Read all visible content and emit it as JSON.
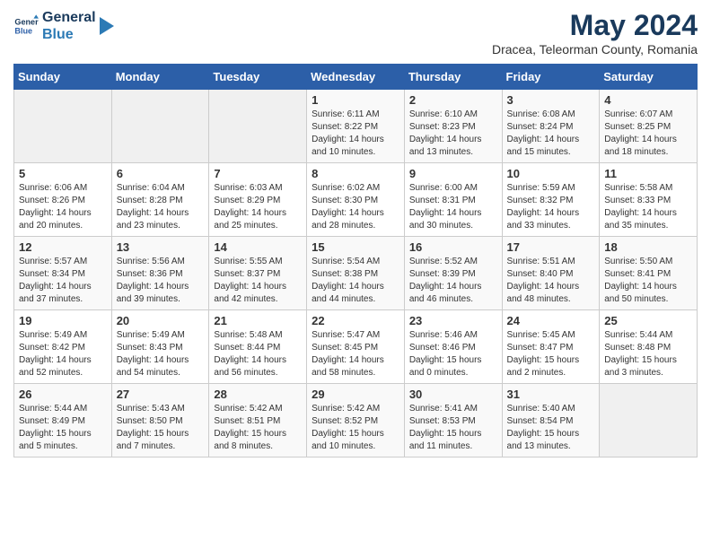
{
  "logo": {
    "line1": "General",
    "line2": "Blue"
  },
  "title": "May 2024",
  "location": "Dracea, Teleorman County, Romania",
  "days_of_week": [
    "Sunday",
    "Monday",
    "Tuesday",
    "Wednesday",
    "Thursday",
    "Friday",
    "Saturday"
  ],
  "weeks": [
    [
      {
        "num": "",
        "info": ""
      },
      {
        "num": "",
        "info": ""
      },
      {
        "num": "",
        "info": ""
      },
      {
        "num": "1",
        "info": "Sunrise: 6:11 AM\nSunset: 8:22 PM\nDaylight: 14 hours\nand 10 minutes."
      },
      {
        "num": "2",
        "info": "Sunrise: 6:10 AM\nSunset: 8:23 PM\nDaylight: 14 hours\nand 13 minutes."
      },
      {
        "num": "3",
        "info": "Sunrise: 6:08 AM\nSunset: 8:24 PM\nDaylight: 14 hours\nand 15 minutes."
      },
      {
        "num": "4",
        "info": "Sunrise: 6:07 AM\nSunset: 8:25 PM\nDaylight: 14 hours\nand 18 minutes."
      }
    ],
    [
      {
        "num": "5",
        "info": "Sunrise: 6:06 AM\nSunset: 8:26 PM\nDaylight: 14 hours\nand 20 minutes."
      },
      {
        "num": "6",
        "info": "Sunrise: 6:04 AM\nSunset: 8:28 PM\nDaylight: 14 hours\nand 23 minutes."
      },
      {
        "num": "7",
        "info": "Sunrise: 6:03 AM\nSunset: 8:29 PM\nDaylight: 14 hours\nand 25 minutes."
      },
      {
        "num": "8",
        "info": "Sunrise: 6:02 AM\nSunset: 8:30 PM\nDaylight: 14 hours\nand 28 minutes."
      },
      {
        "num": "9",
        "info": "Sunrise: 6:00 AM\nSunset: 8:31 PM\nDaylight: 14 hours\nand 30 minutes."
      },
      {
        "num": "10",
        "info": "Sunrise: 5:59 AM\nSunset: 8:32 PM\nDaylight: 14 hours\nand 33 minutes."
      },
      {
        "num": "11",
        "info": "Sunrise: 5:58 AM\nSunset: 8:33 PM\nDaylight: 14 hours\nand 35 minutes."
      }
    ],
    [
      {
        "num": "12",
        "info": "Sunrise: 5:57 AM\nSunset: 8:34 PM\nDaylight: 14 hours\nand 37 minutes."
      },
      {
        "num": "13",
        "info": "Sunrise: 5:56 AM\nSunset: 8:36 PM\nDaylight: 14 hours\nand 39 minutes."
      },
      {
        "num": "14",
        "info": "Sunrise: 5:55 AM\nSunset: 8:37 PM\nDaylight: 14 hours\nand 42 minutes."
      },
      {
        "num": "15",
        "info": "Sunrise: 5:54 AM\nSunset: 8:38 PM\nDaylight: 14 hours\nand 44 minutes."
      },
      {
        "num": "16",
        "info": "Sunrise: 5:52 AM\nSunset: 8:39 PM\nDaylight: 14 hours\nand 46 minutes."
      },
      {
        "num": "17",
        "info": "Sunrise: 5:51 AM\nSunset: 8:40 PM\nDaylight: 14 hours\nand 48 minutes."
      },
      {
        "num": "18",
        "info": "Sunrise: 5:50 AM\nSunset: 8:41 PM\nDaylight: 14 hours\nand 50 minutes."
      }
    ],
    [
      {
        "num": "19",
        "info": "Sunrise: 5:49 AM\nSunset: 8:42 PM\nDaylight: 14 hours\nand 52 minutes."
      },
      {
        "num": "20",
        "info": "Sunrise: 5:49 AM\nSunset: 8:43 PM\nDaylight: 14 hours\nand 54 minutes."
      },
      {
        "num": "21",
        "info": "Sunrise: 5:48 AM\nSunset: 8:44 PM\nDaylight: 14 hours\nand 56 minutes."
      },
      {
        "num": "22",
        "info": "Sunrise: 5:47 AM\nSunset: 8:45 PM\nDaylight: 14 hours\nand 58 minutes."
      },
      {
        "num": "23",
        "info": "Sunrise: 5:46 AM\nSunset: 8:46 PM\nDaylight: 15 hours\nand 0 minutes."
      },
      {
        "num": "24",
        "info": "Sunrise: 5:45 AM\nSunset: 8:47 PM\nDaylight: 15 hours\nand 2 minutes."
      },
      {
        "num": "25",
        "info": "Sunrise: 5:44 AM\nSunset: 8:48 PM\nDaylight: 15 hours\nand 3 minutes."
      }
    ],
    [
      {
        "num": "26",
        "info": "Sunrise: 5:44 AM\nSunset: 8:49 PM\nDaylight: 15 hours\nand 5 minutes."
      },
      {
        "num": "27",
        "info": "Sunrise: 5:43 AM\nSunset: 8:50 PM\nDaylight: 15 hours\nand 7 minutes."
      },
      {
        "num": "28",
        "info": "Sunrise: 5:42 AM\nSunset: 8:51 PM\nDaylight: 15 hours\nand 8 minutes."
      },
      {
        "num": "29",
        "info": "Sunrise: 5:42 AM\nSunset: 8:52 PM\nDaylight: 15 hours\nand 10 minutes."
      },
      {
        "num": "30",
        "info": "Sunrise: 5:41 AM\nSunset: 8:53 PM\nDaylight: 15 hours\nand 11 minutes."
      },
      {
        "num": "31",
        "info": "Sunrise: 5:40 AM\nSunset: 8:54 PM\nDaylight: 15 hours\nand 13 minutes."
      },
      {
        "num": "",
        "info": ""
      }
    ]
  ]
}
